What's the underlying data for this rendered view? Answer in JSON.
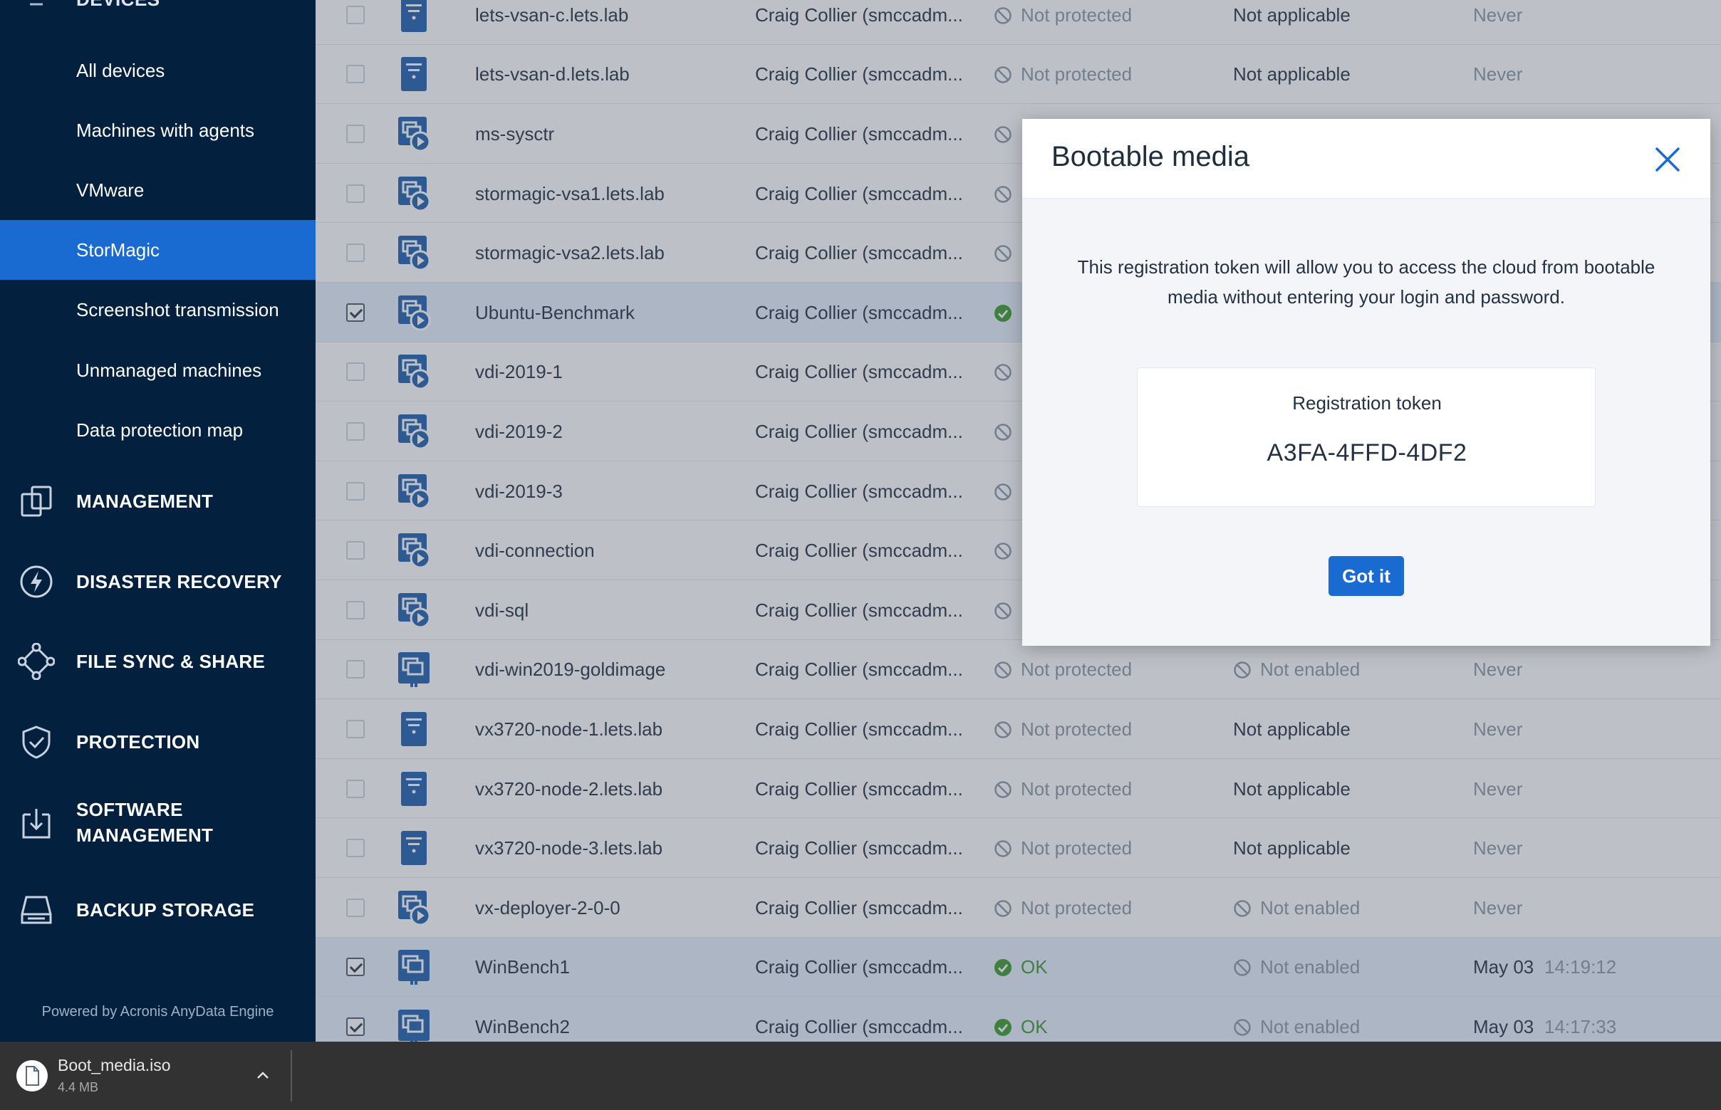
{
  "sidebar": {
    "header": {
      "label": "DEVICES",
      "icon": "devices-icon"
    },
    "sub_items": [
      {
        "label": "All devices",
        "active": false
      },
      {
        "label": "Machines with agents",
        "active": false
      },
      {
        "label": "VMware",
        "active": false
      },
      {
        "label": "StorMagic",
        "active": true
      },
      {
        "label": "Screenshot transmission",
        "active": false
      },
      {
        "label": "Unmanaged machines",
        "active": false
      },
      {
        "label": "Data protection map",
        "active": false
      }
    ],
    "sections": [
      {
        "label": "MANAGEMENT",
        "icon": "management-icon"
      },
      {
        "label": "DISASTER RECOVERY",
        "icon": "disaster-recovery-icon"
      },
      {
        "label": "FILE SYNC & SHARE",
        "icon": "file-sync-icon"
      },
      {
        "label": "PROTECTION",
        "icon": "shield-icon"
      },
      {
        "label": "SOFTWARE MANAGEMENT",
        "line1": "SOFTWARE",
        "line2": "MANAGEMENT",
        "icon": "software-management-icon"
      },
      {
        "label": "BACKUP STORAGE",
        "icon": "backup-storage-icon"
      }
    ],
    "footer": "Powered by Acronis AnyData Engine"
  },
  "devices": [
    {
      "name": "lets-vsan-c.lets.lab",
      "account": "Craig Collier (smccadm...",
      "type": "server",
      "checked": false,
      "status": "Not protected",
      "status_kind": "none",
      "col5": "Not applicable",
      "col5_kind": "plain",
      "last_backup": "Never",
      "time": ""
    },
    {
      "name": "lets-vsan-d.lets.lab",
      "account": "Craig Collier (smccadm...",
      "type": "server",
      "checked": false,
      "status": "Not protected",
      "status_kind": "none",
      "col5": "Not applicable",
      "col5_kind": "plain",
      "last_backup": "Never",
      "time": ""
    },
    {
      "name": "ms-sysctr",
      "account": "Craig Collier (smccadm...",
      "type": "vm",
      "checked": false,
      "status": "",
      "status_kind": "none",
      "col5": "",
      "col5_kind": "plain",
      "last_backup": "",
      "time": ""
    },
    {
      "name": "stormagic-vsa1.lets.lab",
      "account": "Craig Collier (smccadm...",
      "type": "vm",
      "checked": false,
      "status": "",
      "status_kind": "none",
      "col5": "",
      "col5_kind": "plain",
      "last_backup": "",
      "time": ""
    },
    {
      "name": "stormagic-vsa2.lets.lab",
      "account": "Craig Collier (smccadm...",
      "type": "vm",
      "checked": false,
      "status": "",
      "status_kind": "none",
      "col5": "",
      "col5_kind": "plain",
      "last_backup": "",
      "time": ""
    },
    {
      "name": "Ubuntu-Benchmark",
      "account": "Craig Collier (smccadm...",
      "type": "vm",
      "checked": true,
      "status": "",
      "status_kind": "ok",
      "col5": "",
      "col5_kind": "plain",
      "last_backup": "",
      "time": ""
    },
    {
      "name": "vdi-2019-1",
      "account": "Craig Collier (smccadm...",
      "type": "vm",
      "checked": false,
      "status": "",
      "status_kind": "none",
      "col5": "",
      "col5_kind": "plain",
      "last_backup": "",
      "time": ""
    },
    {
      "name": "vdi-2019-2",
      "account": "Craig Collier (smccadm...",
      "type": "vm",
      "checked": false,
      "status": "",
      "status_kind": "none",
      "col5": "",
      "col5_kind": "plain",
      "last_backup": "",
      "time": ""
    },
    {
      "name": "vdi-2019-3",
      "account": "Craig Collier (smccadm...",
      "type": "vm",
      "checked": false,
      "status": "",
      "status_kind": "none",
      "col5": "",
      "col5_kind": "plain",
      "last_backup": "",
      "time": ""
    },
    {
      "name": "vdi-connection",
      "account": "Craig Collier (smccadm...",
      "type": "vm",
      "checked": false,
      "status": "",
      "status_kind": "none",
      "col5": "",
      "col5_kind": "plain",
      "last_backup": "",
      "time": ""
    },
    {
      "name": "vdi-sql",
      "account": "Craig Collier (smccadm...",
      "type": "vm",
      "checked": false,
      "status": "",
      "status_kind": "none",
      "col5": "",
      "col5_kind": "plain",
      "last_backup": "",
      "time": ""
    },
    {
      "name": "vdi-win2019-goldimage",
      "account": "Craig Collier (smccadm...",
      "type": "vm-stack",
      "checked": false,
      "status": "Not protected",
      "status_kind": "none",
      "col5": "Not enabled",
      "col5_kind": "none",
      "last_backup": "Never",
      "time": ""
    },
    {
      "name": "vx3720-node-1.lets.lab",
      "account": "Craig Collier (smccadm...",
      "type": "server",
      "checked": false,
      "status": "Not protected",
      "status_kind": "none",
      "col5": "Not applicable",
      "col5_kind": "plain",
      "last_backup": "Never",
      "time": ""
    },
    {
      "name": "vx3720-node-2.lets.lab",
      "account": "Craig Collier (smccadm...",
      "type": "server",
      "checked": false,
      "status": "Not protected",
      "status_kind": "none",
      "col5": "Not applicable",
      "col5_kind": "plain",
      "last_backup": "Never",
      "time": ""
    },
    {
      "name": "vx3720-node-3.lets.lab",
      "account": "Craig Collier (smccadm...",
      "type": "server",
      "checked": false,
      "status": "Not protected",
      "status_kind": "none",
      "col5": "Not applicable",
      "col5_kind": "plain",
      "last_backup": "Never",
      "time": ""
    },
    {
      "name": "vx-deployer-2-0-0",
      "account": "Craig Collier (smccadm...",
      "type": "vm",
      "checked": false,
      "status": "Not protected",
      "status_kind": "none",
      "col5": "Not enabled",
      "col5_kind": "none",
      "last_backup": "Never",
      "time": ""
    },
    {
      "name": "WinBench1",
      "account": "Craig Collier (smccadm...",
      "type": "vm-stack",
      "checked": true,
      "status": "OK",
      "status_kind": "ok",
      "col5": "Not enabled",
      "col5_kind": "none",
      "last_backup": "May 03",
      "time": "14:19:12"
    },
    {
      "name": "WinBench2",
      "account": "Craig Collier (smccadm...",
      "type": "vm-stack",
      "checked": true,
      "status": "OK",
      "status_kind": "ok",
      "col5": "Not enabled",
      "col5_kind": "none",
      "last_backup": "May 03",
      "time": "14:17:33"
    }
  ],
  "modal": {
    "title": "Bootable media",
    "description": "This registration token will allow you to access the cloud from bootable media without entering your login and password.",
    "token_label": "Registration token",
    "token_value": "A3FA-4FFD-4DF2",
    "button_label": "Got it",
    "close_icon": "close-icon"
  },
  "download": {
    "filename": "Boot_media.iso",
    "size": "4.4 MB",
    "icon": "file-icon"
  },
  "colors": {
    "sidebar_bg": "#04203f",
    "accent": "#1a6bd1",
    "ok_green": "#3a9a2e",
    "icon_blue": "#1f5fae",
    "muted": "#8a96a6"
  }
}
